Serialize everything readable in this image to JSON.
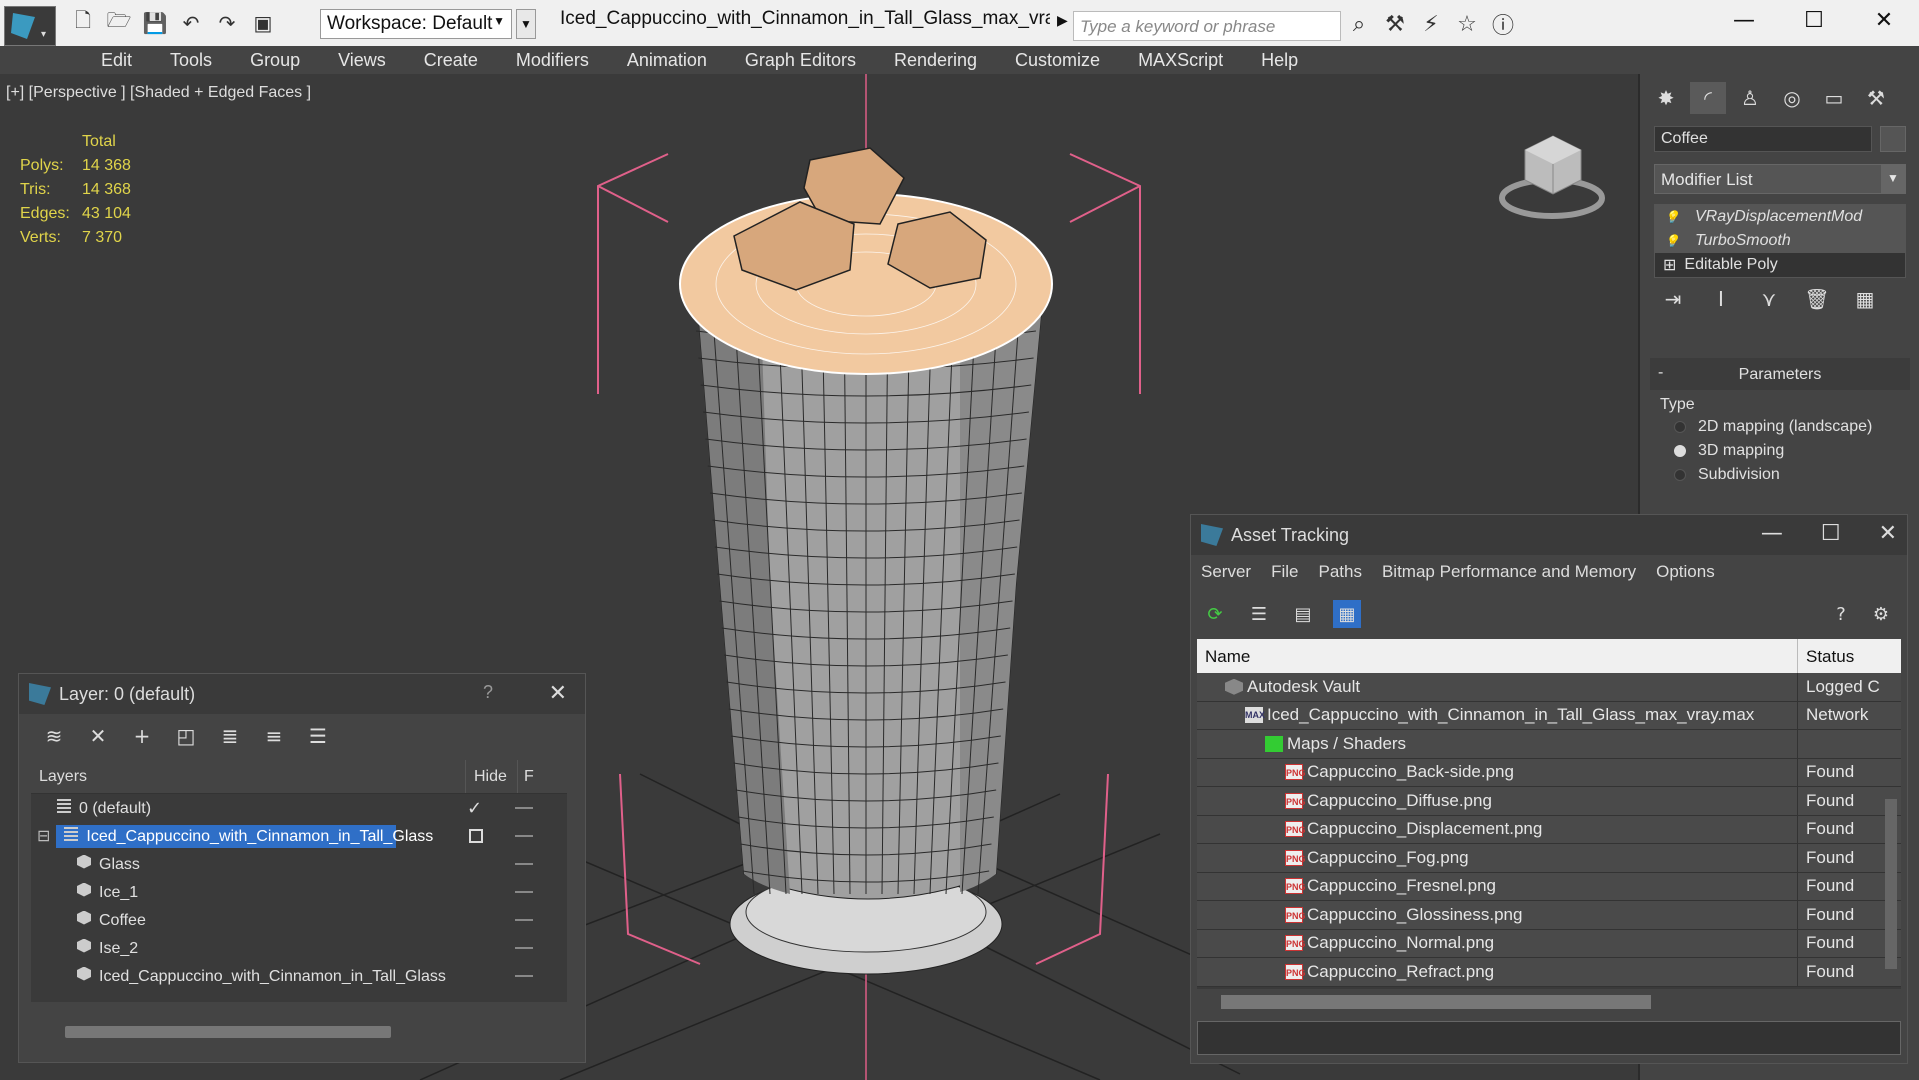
{
  "titlebar": {
    "workspace": "Workspace: Default",
    "document_title": "Iced_Cappuccino_with_Cinnamon_in_Tall_Glass_max_vray.m...",
    "search_placeholder": "Type a keyword or phrase"
  },
  "menu": [
    "Edit",
    "Tools",
    "Group",
    "Views",
    "Create",
    "Modifiers",
    "Animation",
    "Graph Editors",
    "Rendering",
    "Customize",
    "MAXScript",
    "Help"
  ],
  "viewport": {
    "label": "[+] [Perspective ] [Shaded + Edged Faces ]",
    "stats": {
      "header": "Total",
      "rows": [
        {
          "k": "Polys:",
          "v": "14 368"
        },
        {
          "k": "Tris:",
          "v": "14 368"
        },
        {
          "k": "Edges:",
          "v": "43 104"
        },
        {
          "k": "Verts:",
          "v": "7 370"
        }
      ]
    }
  },
  "command_panel": {
    "object_name": "Coffee",
    "modifier_list": "Modifier List",
    "stack": [
      "VRayDisplacementMod",
      "TurboSmooth",
      "Editable Poly"
    ],
    "rollout": "Parameters",
    "type_label": "Type",
    "radios": [
      {
        "label": "2D mapping (landscape)",
        "selected": false
      },
      {
        "label": "3D mapping",
        "selected": true
      },
      {
        "label": "Subdivision",
        "selected": false
      }
    ]
  },
  "layer_window": {
    "title": "Layer: 0 (default)",
    "help": "?",
    "col_layers": "Layers",
    "col_hide": "Hide",
    "col_f": "F",
    "rows": [
      {
        "name": "0 (default)",
        "type": "layer",
        "indent": 1,
        "selected": false,
        "current": true
      },
      {
        "name": "Iced_Cappuccino_with_Cinnamon_in_Tall_Glass",
        "type": "layer",
        "indent": 0,
        "selected": true,
        "current": false
      },
      {
        "name": "Glass",
        "type": "object",
        "indent": 2,
        "selected": false,
        "current": false
      },
      {
        "name": "Ice_1",
        "type": "object",
        "indent": 2,
        "selected": false,
        "current": false
      },
      {
        "name": "Coffee",
        "type": "object",
        "indent": 2,
        "selected": false,
        "current": false
      },
      {
        "name": "Ise_2",
        "type": "object",
        "indent": 2,
        "selected": false,
        "current": false
      },
      {
        "name": "Iced_Cappuccino_with_Cinnamon_in_Tall_Glass",
        "type": "object",
        "indent": 2,
        "selected": false,
        "current": false
      }
    ]
  },
  "asset_window": {
    "title": "Asset Tracking",
    "menu": [
      "Server",
      "File",
      "Paths",
      "Bitmap Performance and Memory",
      "Options"
    ],
    "col_name": "Name",
    "col_status": "Status",
    "rows": [
      {
        "name": "Autodesk Vault",
        "icon": "vault",
        "indent": 1,
        "status": "Logged C"
      },
      {
        "name": "Iced_Cappuccino_with_Cinnamon_in_Tall_Glass_max_vray.max",
        "icon": "max",
        "indent": 2,
        "status": "Network"
      },
      {
        "name": "Maps / Shaders",
        "icon": "maps",
        "indent": 3,
        "status": ""
      },
      {
        "name": "Cappuccino_Back-side.png",
        "icon": "png",
        "indent": 4,
        "status": "Found"
      },
      {
        "name": "Cappuccino_Diffuse.png",
        "icon": "png",
        "indent": 4,
        "status": "Found"
      },
      {
        "name": "Cappuccino_Displacement.png",
        "icon": "png",
        "indent": 4,
        "status": "Found"
      },
      {
        "name": "Cappuccino_Fog.png",
        "icon": "png",
        "indent": 4,
        "status": "Found"
      },
      {
        "name": "Cappuccino_Fresnel.png",
        "icon": "png",
        "indent": 4,
        "status": "Found"
      },
      {
        "name": "Cappuccino_Glossiness.png",
        "icon": "png",
        "indent": 4,
        "status": "Found"
      },
      {
        "name": "Cappuccino_Normal.png",
        "icon": "png",
        "indent": 4,
        "status": "Found"
      },
      {
        "name": "Cappuccino_Refract.png",
        "icon": "png",
        "indent": 4,
        "status": "Found"
      }
    ]
  },
  "colors": {
    "selection": "#2f6fc7",
    "stats_text": "#e0d44a",
    "foam": "#f2c9a0",
    "bbox": "#e0608a"
  }
}
